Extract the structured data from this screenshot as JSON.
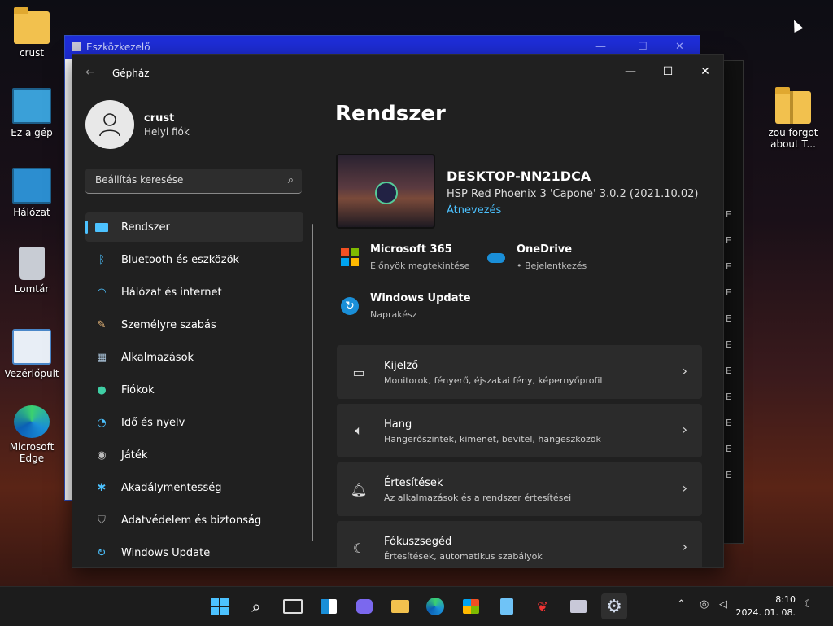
{
  "desktop": {
    "icons": [
      {
        "label": "crust"
      },
      {
        "label": "Ez a gép"
      },
      {
        "label": "Hálózat"
      },
      {
        "label": "Lomtár"
      },
      {
        "label": "Vezérlőpult"
      },
      {
        "label": "Microsoft Edge"
      },
      {
        "label": "zou forgot about T..."
      }
    ]
  },
  "devmgr": {
    "title": "Eszközkezelő"
  },
  "settings": {
    "app_title": "Gépház",
    "profile": {
      "name": "crust",
      "account": "Helyi fiók"
    },
    "search": {
      "placeholder": "Beállítás keresése"
    },
    "nav": [
      {
        "label": "Rendszer"
      },
      {
        "label": "Bluetooth és eszközök"
      },
      {
        "label": "Hálózat és internet"
      },
      {
        "label": "Személyre szabás"
      },
      {
        "label": "Alkalmazások"
      },
      {
        "label": "Fiókok"
      },
      {
        "label": "Idő és nyelv"
      },
      {
        "label": "Játék"
      },
      {
        "label": "Akadálymentesség"
      },
      {
        "label": "Adatvédelem és biztonság"
      },
      {
        "label": "Windows Update"
      }
    ],
    "heading": "Rendszer",
    "device": {
      "name": "DESKTOP-NN21DCA",
      "edition": "HSP Red Phoenix 3 'Capone' 3.0.2 (2021.10.02)",
      "rename": "Átnevezés"
    },
    "tiles": {
      "m365": {
        "title": "Microsoft 365",
        "sub": "Előnyök megtekintése"
      },
      "onedrive": {
        "title": "OneDrive",
        "sub": "• Bejelentkezés"
      },
      "wu": {
        "title": "Windows Update",
        "sub": "Naprakész"
      }
    },
    "cards": [
      {
        "title": "Kijelző",
        "sub": "Monitorok, fényerő, éjszakai fény, képernyőprofil"
      },
      {
        "title": "Hang",
        "sub": "Hangerőszintek, kimenet, bevitel, hangeszközök"
      },
      {
        "title": "Értesítések",
        "sub": "Az alkalmazások és a rendszer értesítései"
      },
      {
        "title": "Fókuszsegéd",
        "sub": "Értesítések, automatikus szabályok"
      }
    ]
  },
  "taskbar": {
    "time": "8:10",
    "date": "2024. 01. 08."
  },
  "colors": {
    "accent": "#4cc2ff",
    "devmgr_bar": "#1e2dd8"
  }
}
